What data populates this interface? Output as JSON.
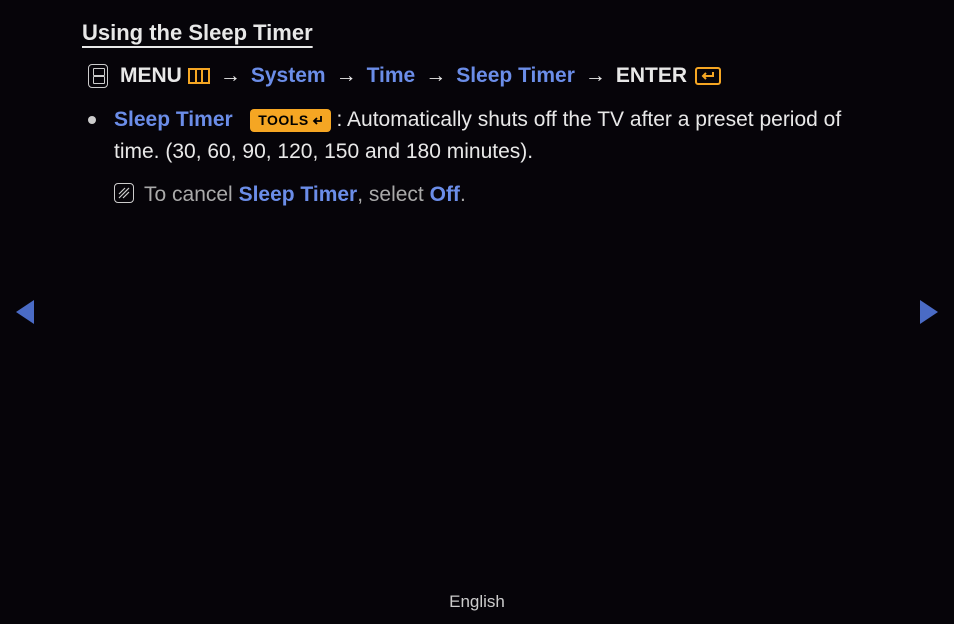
{
  "title": "Using the Sleep Timer",
  "nav": {
    "menu": "MENU",
    "system": "System",
    "time": "Time",
    "sleep_timer": "Sleep Timer",
    "enter": "ENTER",
    "arrow": "→"
  },
  "bullet": {
    "label": "Sleep Timer",
    "tools": "TOOLS",
    "desc": ": Automatically shuts off the TV after a preset period of time. (30, 60, 90, 120, 150 and 180 minutes)."
  },
  "note": {
    "prefix": "To cancel ",
    "highlight": "Sleep Timer",
    "mid": ", select ",
    "off": "Off",
    "suffix": "."
  },
  "footer": "English"
}
